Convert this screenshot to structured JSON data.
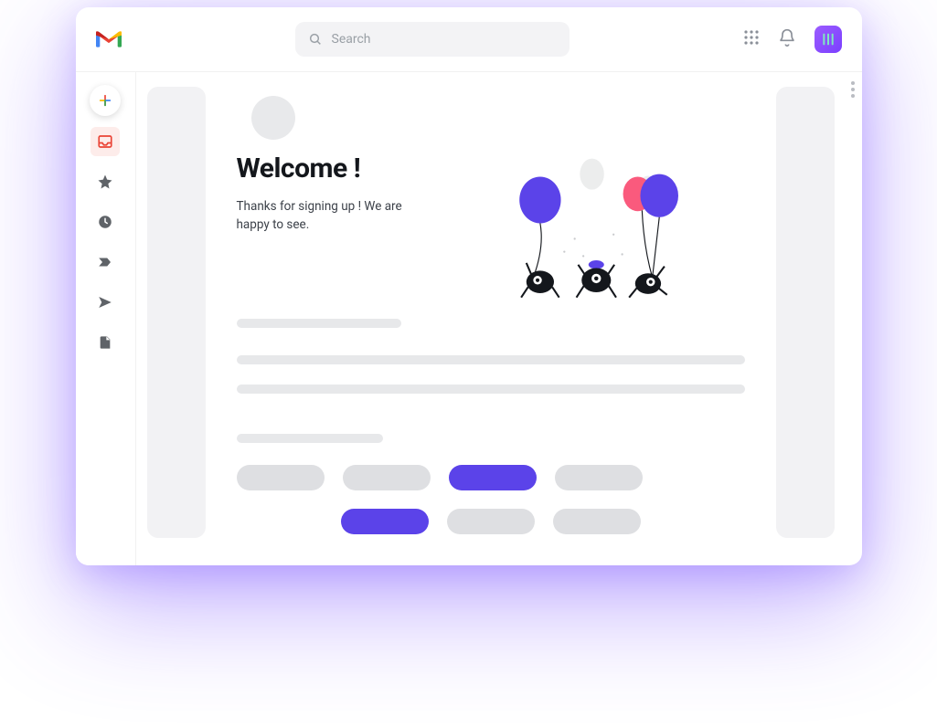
{
  "header": {
    "search_placeholder": "Search"
  },
  "email": {
    "title": "Welcome !",
    "subtitle": "Thanks for signing up ! We are happy to see."
  },
  "colors": {
    "accent": "#5b43e9",
    "skeleton": "#e7e8ea",
    "balloon_pink": "#fa5a7d"
  }
}
